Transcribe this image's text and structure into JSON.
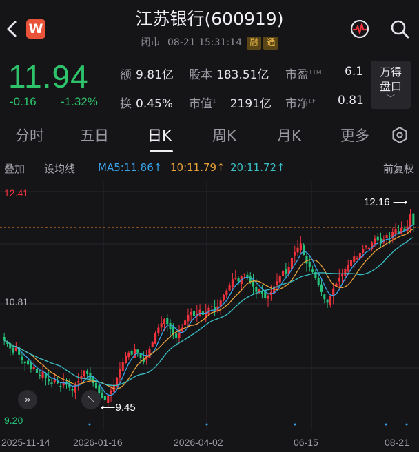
{
  "header": {
    "title": "江苏银行(600919)",
    "status": "闭市",
    "datetime": "08-21 15:31:14",
    "tags": [
      "融",
      "通"
    ],
    "logo_letter": "W"
  },
  "quote": {
    "price": "11.94",
    "change": "-0.16",
    "change_pct": "-1.32%",
    "stats": [
      {
        "label": "额",
        "value": "9.81亿"
      },
      {
        "label": "股本",
        "value": "183.51亿"
      },
      {
        "label": "市盈",
        "sup": "TTM",
        "value": "6.1"
      },
      {
        "label": "换",
        "value": "0.45%"
      },
      {
        "label": "市值",
        "sup": "1",
        "value": "2191亿"
      },
      {
        "label": "市净",
        "sup": "LF",
        "value": "0.81"
      }
    ],
    "wande_button": [
      "万得",
      "盘口"
    ]
  },
  "tabs": [
    "分时",
    "五日",
    "日K",
    "周K",
    "月K",
    "更多"
  ],
  "active_tab": "日K",
  "toolbar": {
    "overlay": "叠加",
    "ma_setting": "设均线",
    "ma5": "MA5:11.86↑",
    "ma10": "10:11.79↑",
    "ma20": "20:11.72↑",
    "adjust": "前复权"
  },
  "chart_data": {
    "type": "candlestick",
    "ylim": [
      9.2,
      12.41
    ],
    "y_labels": [
      "12.41",
      "10.81",
      "9.20"
    ],
    "x_labels": [
      "2025-11-14",
      "2026-01-16",
      "2026-04-02",
      "06-15",
      "08-21"
    ],
    "last_close": 11.94,
    "annotations": [
      {
        "text": "12.16",
        "value": 12.16,
        "kind": "high"
      },
      {
        "text": "9.45",
        "value": 9.45,
        "kind": "low"
      }
    ],
    "colors": {
      "up": "#f0323c",
      "down": "#27c27a",
      "ma5": "#3aa3e8",
      "ma10": "#e8a23a",
      "ma20": "#3ac0c4",
      "ref": "#f08a2c"
    },
    "closes": [
      10.32,
      10.28,
      10.21,
      10.15,
      10.22,
      10.12,
      10.05,
      10.0,
      9.98,
      9.92,
      9.95,
      9.86,
      9.82,
      9.88,
      9.8,
      9.75,
      9.71,
      9.78,
      9.72,
      9.68,
      9.74,
      9.7,
      9.66,
      9.62,
      9.7,
      9.75,
      9.82,
      9.9,
      9.85,
      9.78,
      9.72,
      9.65,
      9.58,
      9.52,
      9.48,
      9.55,
      9.62,
      9.7,
      9.8,
      9.92,
      10.02,
      10.1,
      10.15,
      10.12,
      10.2,
      10.15,
      10.08,
      10.02,
      10.1,
      10.2,
      10.3,
      10.42,
      10.5,
      10.56,
      10.62,
      10.55,
      10.48,
      10.4,
      10.35,
      10.42,
      10.5,
      10.6,
      10.68,
      10.72,
      10.66,
      10.7,
      10.75,
      10.68,
      10.72,
      10.78,
      10.8,
      10.74,
      10.8,
      10.88,
      10.96,
      11.02,
      11.1,
      11.18,
      11.2,
      11.15,
      11.22,
      11.26,
      11.2,
      11.14,
      11.08,
      11.0,
      11.04,
      10.98,
      10.92,
      10.95,
      11.0,
      11.08,
      11.15,
      11.22,
      11.3,
      11.25,
      11.35,
      11.48,
      11.56,
      11.62,
      11.68,
      11.52,
      11.4,
      11.35,
      11.28,
      11.2,
      11.1,
      11.0,
      10.9,
      10.85,
      10.95,
      11.05,
      11.12,
      11.2,
      11.26,
      11.32,
      11.38,
      11.45,
      11.5,
      11.48,
      11.55,
      11.6,
      11.65,
      11.62,
      11.7,
      11.75,
      11.72,
      11.68,
      11.74,
      11.8,
      11.78,
      11.84,
      11.88,
      11.82,
      11.9,
      11.86,
      11.92,
      12.1,
      11.94
    ]
  },
  "chart_controls": {
    "expand": "»",
    "collapse": "⤡"
  }
}
